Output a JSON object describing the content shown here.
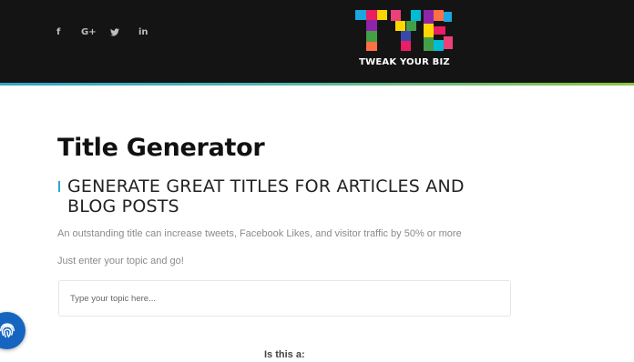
{
  "header": {
    "social": [
      {
        "name": "facebook",
        "icon": "facebook-icon",
        "glyph": "f"
      },
      {
        "name": "google-plus",
        "icon": "google-plus-icon",
        "glyph": "G+"
      },
      {
        "name": "twitter",
        "icon": "twitter-icon"
      },
      {
        "name": "linkedin",
        "icon": "linkedin-icon",
        "glyph": "in"
      }
    ],
    "logo": {
      "brand_text": "TWEAK YOUR BIZ",
      "colors": [
        "#1aa6e0",
        "#e91e63",
        "#ffd600",
        "#8e24aa",
        "#43a047",
        "#ff7043",
        "#3949ab",
        "#ec407a",
        "#00bcd4"
      ]
    },
    "accent_colors": [
      "#2ea6c9",
      "#8cc63f"
    ]
  },
  "main": {
    "title": "Title Generator",
    "subtitle": "GENERATE GREAT TITLES FOR ARTICLES AND BLOG POSTS",
    "description": "An outstanding title can increase tweets, Facebook Likes, and visitor traffic by 50% or more",
    "hint": "Just enter your topic and go!",
    "topic_input": {
      "placeholder": "Type your topic here...",
      "value": ""
    },
    "question": "Is this a:"
  },
  "floating": {
    "icon": "fingerprint-icon",
    "color": "#1565c0"
  }
}
